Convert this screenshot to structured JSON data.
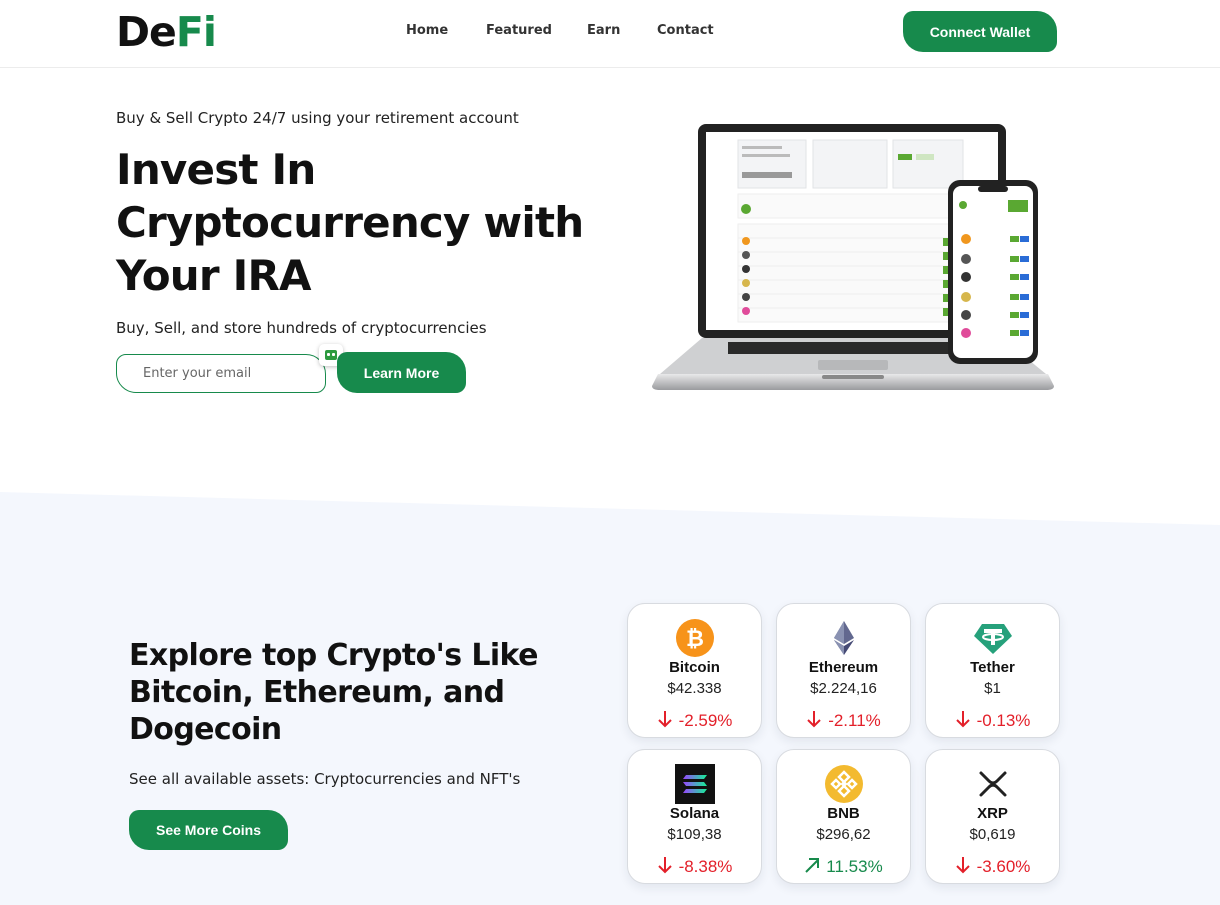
{
  "header": {
    "logo_de": "De",
    "logo_fi": "Fi",
    "nav": [
      "Home",
      "Featured",
      "Earn",
      "Contact"
    ],
    "connect_label": "Connect Wallet"
  },
  "hero": {
    "tagline": "Buy & Sell Crypto 24/7 using your retirement account",
    "title": "Invest In Cryptocurrency with Your IRA",
    "subtitle": "Buy, Sell, and store hundreds of cryptocurrencies",
    "email_placeholder": "Enter your email",
    "learn_label": "Learn More"
  },
  "explore": {
    "title": "Explore top Crypto's Like Bitcoin, Ethereum, and Dogecoin",
    "subtitle": "See all available assets: Cryptocurrencies and NFT's",
    "button_label": "See More Coins"
  },
  "coins": [
    {
      "name": "Bitcoin",
      "price": "$42.338",
      "change": "-2.59%",
      "direction": "down",
      "icon": "bitcoin-icon"
    },
    {
      "name": "Ethereum",
      "price": "$2.224,16",
      "change": "-2.11%",
      "direction": "down",
      "icon": "ethereum-icon"
    },
    {
      "name": "Tether",
      "price": "$1",
      "change": "-0.13%",
      "direction": "down",
      "icon": "tether-icon"
    },
    {
      "name": "Solana",
      "price": "$109,38",
      "change": "-8.38%",
      "direction": "down",
      "icon": "solana-icon"
    },
    {
      "name": "BNB",
      "price": "$296,62",
      "change": "11.53%",
      "direction": "up",
      "icon": "bnb-icon"
    },
    {
      "name": "XRP",
      "price": "$0,619",
      "change": "-3.60%",
      "direction": "down",
      "icon": "xrp-icon"
    }
  ],
  "colors": {
    "brand_green": "#178a4c",
    "down_red": "#e3202a",
    "band_background": "#f4f7fd"
  }
}
